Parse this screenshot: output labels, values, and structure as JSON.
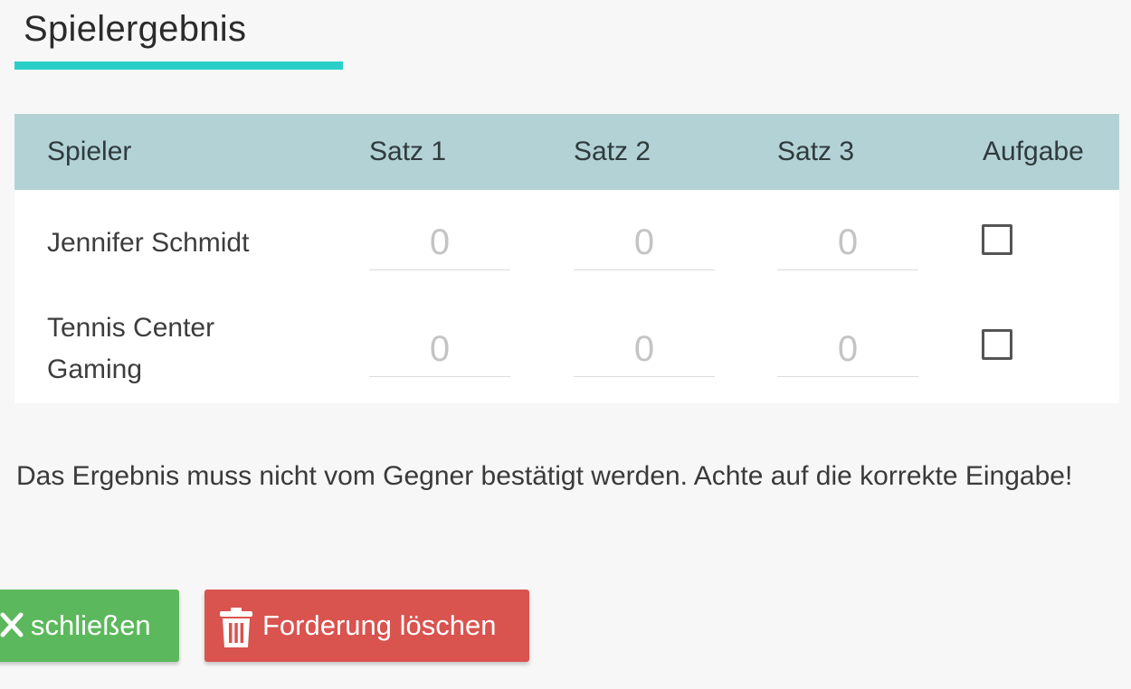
{
  "page": {
    "title": "Spielergebnis",
    "accent_color": "#2ad0c8"
  },
  "table": {
    "headers": {
      "player": "Spieler",
      "set1": "Satz 1",
      "set2": "Satz 2",
      "set3": "Satz 3",
      "retire": "Aufgabe"
    },
    "header_bg": "#b3d2d6",
    "rows": [
      {
        "player": "Jennifer Schmidt",
        "set1_placeholder": "0",
        "set2_placeholder": "0",
        "set3_placeholder": "0",
        "retired": false
      },
      {
        "player_line1": "Tennis Center",
        "player_line2": "Gaming",
        "set1_placeholder": "0",
        "set2_placeholder": "0",
        "set3_placeholder": "0",
        "retired": false
      }
    ]
  },
  "info_text": "Das Ergebnis muss nicht vom Gegner bestätigt werden. Achte auf die korrekte Eingabe!",
  "buttons": {
    "close": {
      "label": "schließen",
      "icon": "close-icon",
      "color": "#5cb85c"
    },
    "delete": {
      "label": "Forderung löschen",
      "icon": "trash-icon",
      "color": "#d9534f"
    }
  }
}
